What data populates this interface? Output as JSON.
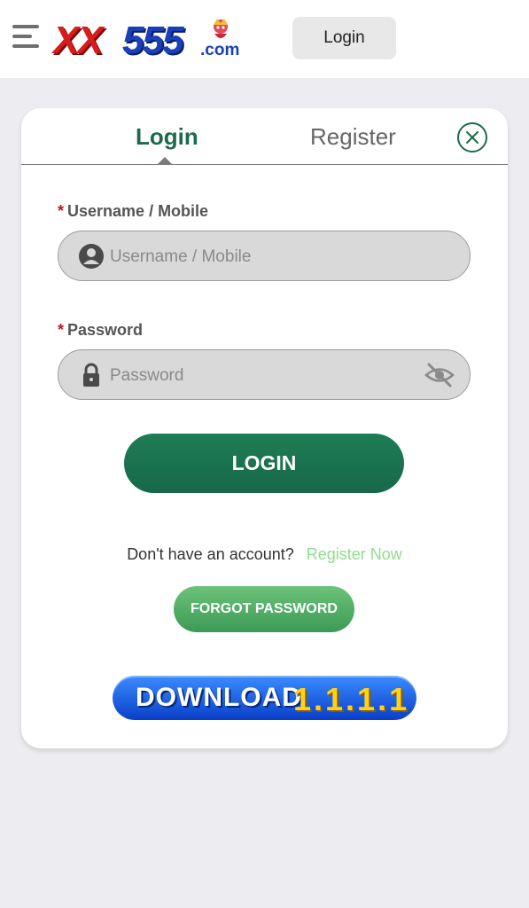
{
  "header": {
    "logo_main": "XX",
    "logo_digits": "555",
    "logo_suffix": ".com",
    "login_button": "Login"
  },
  "tabs": [
    {
      "label": "Login",
      "active": true
    },
    {
      "label": "Register",
      "active": false
    }
  ],
  "form": {
    "username": {
      "required_mark": "*",
      "label": "Username / Mobile",
      "placeholder": "Username / Mobile",
      "value": ""
    },
    "password": {
      "required_mark": "*",
      "label": "Password",
      "placeholder": "Password",
      "value": ""
    },
    "submit_label": "LOGIN"
  },
  "signup": {
    "prompt": "Don't have an account?",
    "link": "Register Now"
  },
  "forgot_button": "FORGOT PASSWORD",
  "download": {
    "label": "DOWNLOAD",
    "version": "1.1.1.1"
  },
  "colors": {
    "primary_green": "#1e6a4c",
    "link_green": "#8fdc8f",
    "required_red": "#c0171c",
    "download_blue": "#1a5fe8",
    "version_yellow": "#ffd21a"
  },
  "icons": [
    "menu-icon",
    "close-icon",
    "user-icon",
    "lock-icon",
    "eye-off-icon"
  ]
}
